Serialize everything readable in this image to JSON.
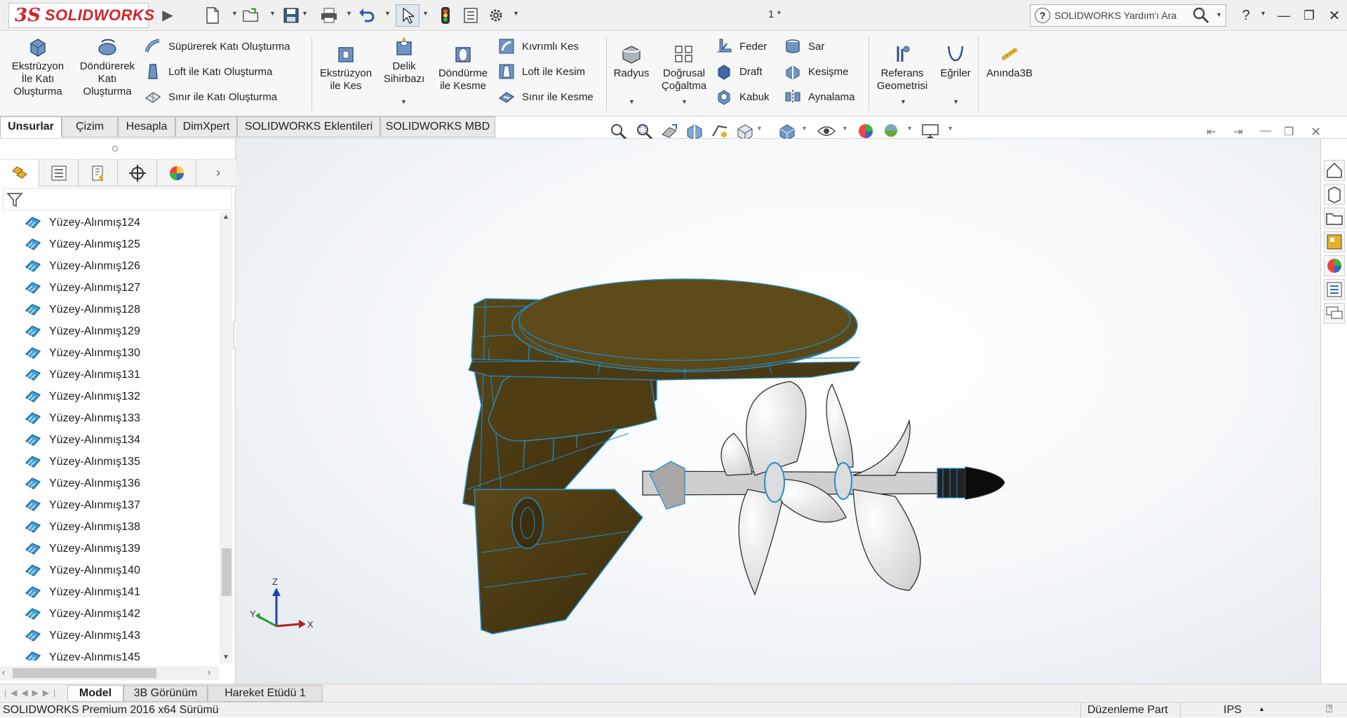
{
  "app": {
    "brand": "SOLIDWORKS",
    "document_title": "1 *",
    "help_search_placeholder": "SOLIDWORKS Yardım'ı Ara",
    "brand_color": "#d2232a"
  },
  "quick_access": {
    "icons": [
      "new-document-icon",
      "open-icon",
      "save-icon",
      "print-icon",
      "undo-icon",
      "select-icon",
      "rebuild-icon",
      "file-properties-icon",
      "options-icon"
    ],
    "help_label": "?"
  },
  "ribbon": {
    "extrude_boss": "Ekstrüzyon İle Katı Oluşturma",
    "revolve_boss": "Döndürerek Katı Oluşturma",
    "swept_boss": "Süpürerek Katı Oluşturma",
    "loft_boss": "Loft ile Katı Oluşturma",
    "boundary_boss": "Sınır ile Katı Oluşturma",
    "extrude_cut": "Ekstrüzyon ile Kes",
    "hole_wizard": "Delik Sihirbazı",
    "revolve_cut": "Döndürme ile Kesme",
    "swept_cut": "Kıvrımlı Kes",
    "loft_cut": "Loft ile Kesim",
    "boundary_cut": "Sınır ile Kesme",
    "fillet": "Radyus",
    "linear_pattern": "Doğrusal Çoğaltma",
    "rib": "Feder",
    "draft": "Draft",
    "shell": "Kabuk",
    "wrap": "Sar",
    "intersect": "Kesişme",
    "mirror": "Aynalama",
    "ref_geometry": "Referans Geometrisi",
    "curves": "Eğriler",
    "instant3d": "Anında3B"
  },
  "command_tabs": [
    "Unsurlar",
    "Çizim",
    "Hesapla",
    "DimXpert",
    "SOLIDWORKS Eklentileri",
    "SOLIDWORKS MBD"
  ],
  "feature_tree": {
    "items": [
      "Yüzey-Alınmış124",
      "Yüzey-Alınmış125",
      "Yüzey-Alınmış126",
      "Yüzey-Alınmış127",
      "Yüzey-Alınmış128",
      "Yüzey-Alınmış129",
      "Yüzey-Alınmış130",
      "Yüzey-Alınmış131",
      "Yüzey-Alınmış132",
      "Yüzey-Alınmış133",
      "Yüzey-Alınmış134",
      "Yüzey-Alınmış135",
      "Yüzey-Alınmış136",
      "Yüzey-Alınmış137",
      "Yüzey-Alınmış138",
      "Yüzey-Alınmış139",
      "Yüzey-Alınmış140",
      "Yüzey-Alınmış141",
      "Yüzey-Alınmış142",
      "Yüzey-Alınmış143",
      "Yüzey-Alınmış145"
    ]
  },
  "triad": {
    "x": "X",
    "y": "Y",
    "z": "Z"
  },
  "bottom_tabs": [
    "Model",
    "3B Görünüm",
    "Hareket Etüdü 1"
  ],
  "status": {
    "version": "SOLIDWORKS Premium 2016 x64 Sürümü",
    "mode": "Düzenleme Part",
    "units": "IPS"
  },
  "colors": {
    "housing": "#4a3a15",
    "edge": "#1f8fd0",
    "prop": "#e9e9e9"
  }
}
